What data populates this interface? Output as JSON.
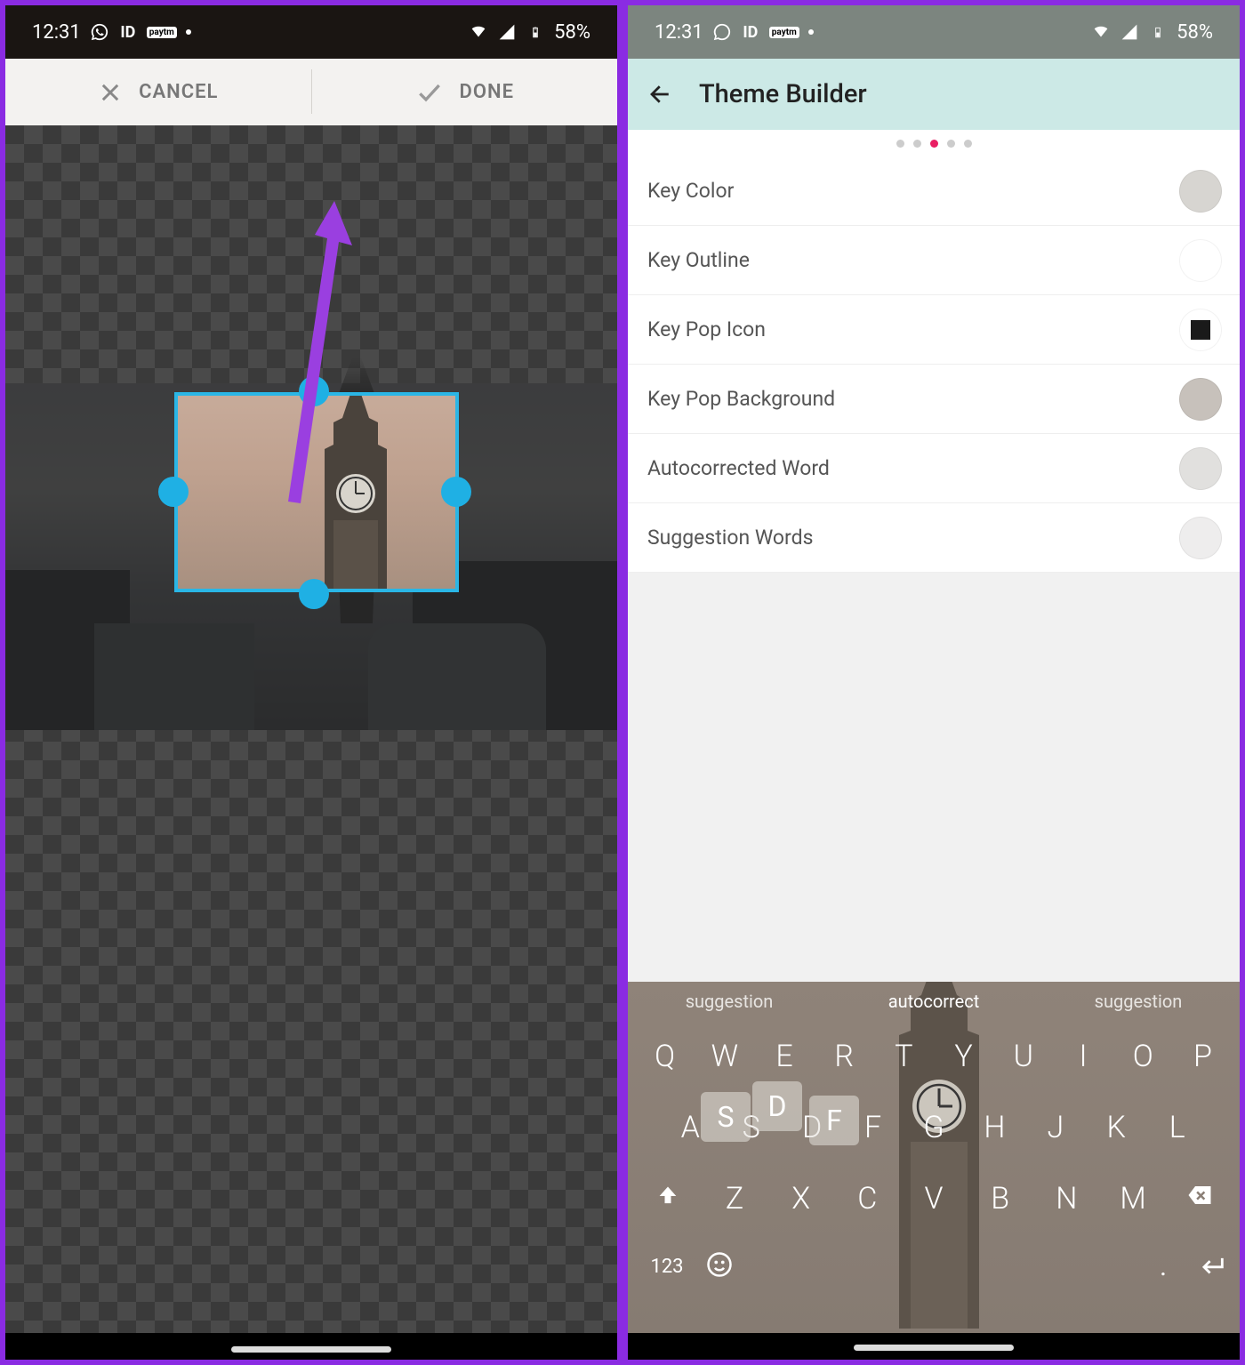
{
  "status": {
    "time": "12:31",
    "battery": "58%"
  },
  "left": {
    "cancel": "CANCEL",
    "done": "DONE"
  },
  "right": {
    "title": "Theme Builder",
    "settings": [
      {
        "label": "Key Color",
        "swatch": "#d7d5d1"
      },
      {
        "label": "Key Outline",
        "swatch": "#ffffff"
      },
      {
        "label": "Key Pop Icon",
        "swatch": "square"
      },
      {
        "label": "Key Pop Background",
        "swatch": "#c7c1bb"
      },
      {
        "label": "Autocorrected Word",
        "swatch": "#e1e0de"
      },
      {
        "label": "Suggestion Words",
        "swatch": "#eeeded"
      }
    ],
    "suggestions": {
      "left": "suggestion",
      "mid": "autocorrect",
      "right": "suggestion"
    },
    "keys": {
      "row1": [
        "Q",
        "W",
        "E",
        "R",
        "T",
        "Y",
        "U",
        "I",
        "O",
        "P"
      ],
      "row2": [
        "A",
        "S",
        "D",
        "F",
        "G",
        "H",
        "J",
        "K",
        "L"
      ],
      "row3": [
        "Z",
        "X",
        "C",
        "V",
        "B",
        "N",
        "M"
      ],
      "num": "123"
    }
  }
}
